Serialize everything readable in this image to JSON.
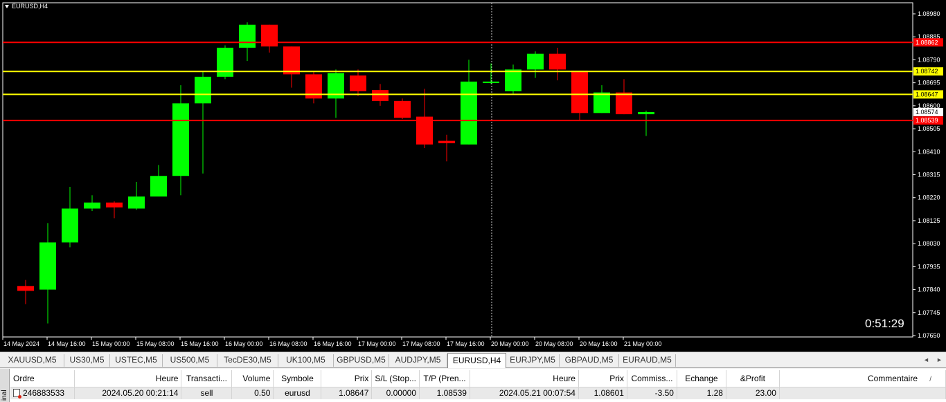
{
  "chart": {
    "symbol_label": "EURUSD,H4",
    "countdown": "0:51:29",
    "colors": {
      "background": "#000000",
      "bull": "#00ff00",
      "bear": "#ff0000",
      "axis_text": "#ffffff",
      "line_red": "#ff0000",
      "line_yellow": "#ffff00"
    },
    "price_axis": {
      "ticks": [
        "1.08980",
        "1.08885",
        "1.08790",
        "1.08695",
        "1.08600",
        "1.08505",
        "1.08410",
        "1.08315",
        "1.08220",
        "1.08125",
        "1.08030",
        "1.07935",
        "1.07840",
        "1.07745",
        "1.07650"
      ]
    },
    "time_axis": {
      "labels": [
        "14 May 2024",
        "14 May 16:00",
        "15 May 00:00",
        "15 May 08:00",
        "15 May 16:00",
        "16 May 00:00",
        "16 May 08:00",
        "16 May 16:00",
        "17 May 00:00",
        "17 May 08:00",
        "17 May 16:00",
        "20 May 00:00",
        "20 May 08:00",
        "20 May 16:00",
        "21 May 00:00"
      ]
    },
    "price_tags": [
      {
        "price": 1.08862,
        "label": "1.08862",
        "bg": "#ff0000",
        "fg": "#ffffff"
      },
      {
        "price": 1.08742,
        "label": "1.08742",
        "bg": "#ffff00",
        "fg": "#000000"
      },
      {
        "price": 1.08647,
        "label": "1.08647",
        "bg": "#ffff00",
        "fg": "#000000"
      },
      {
        "price": 1.08574,
        "label": "1.08574",
        "bg": "#ffffff",
        "fg": "#000000"
      },
      {
        "price": 1.08539,
        "label": "1.08539",
        "bg": "#ff0000",
        "fg": "#ffffff"
      }
    ],
    "horizontal_lines": [
      {
        "price": 1.08862,
        "color": "#ff0000"
      },
      {
        "price": 1.08742,
        "color": "#ffff00"
      },
      {
        "price": 1.08647,
        "color": "#ffff00"
      },
      {
        "price": 1.08539,
        "color": "#ff0000"
      }
    ]
  },
  "chart_data": {
    "type": "candlestick",
    "symbol": "EURUSD",
    "timeframe": "H4",
    "ylim": [
      1.0765,
      1.0898
    ],
    "candles": [
      {
        "o": 1.07855,
        "h": 1.0788,
        "l": 1.0778,
        "c": 1.07835
      },
      {
        "o": 1.0784,
        "h": 1.08115,
        "l": 1.077,
        "c": 1.08035
      },
      {
        "o": 1.08035,
        "h": 1.08265,
        "l": 1.08015,
        "c": 1.08175
      },
      {
        "o": 1.08175,
        "h": 1.0823,
        "l": 1.08165,
        "c": 1.082
      },
      {
        "o": 1.082,
        "h": 1.08205,
        "l": 1.08135,
        "c": 1.0818
      },
      {
        "o": 1.08175,
        "h": 1.08285,
        "l": 1.0817,
        "c": 1.08225
      },
      {
        "o": 1.08225,
        "h": 1.08355,
        "l": 1.08225,
        "c": 1.0831
      },
      {
        "o": 1.0831,
        "h": 1.08685,
        "l": 1.0823,
        "c": 1.0861
      },
      {
        "o": 1.0861,
        "h": 1.0874,
        "l": 1.0832,
        "c": 1.0872
      },
      {
        "o": 1.0872,
        "h": 1.0885,
        "l": 1.0871,
        "c": 1.0884
      },
      {
        "o": 1.0884,
        "h": 1.08945,
        "l": 1.08785,
        "c": 1.08935
      },
      {
        "o": 1.08935,
        "h": 1.08935,
        "l": 1.0882,
        "c": 1.08845
      },
      {
        "o": 1.08845,
        "h": 1.08845,
        "l": 1.08675,
        "c": 1.0873
      },
      {
        "o": 1.0873,
        "h": 1.0874,
        "l": 1.0861,
        "c": 1.0863
      },
      {
        "o": 1.0863,
        "h": 1.0875,
        "l": 1.0855,
        "c": 1.08735
      },
      {
        "o": 1.08725,
        "h": 1.0875,
        "l": 1.0864,
        "c": 1.0866
      },
      {
        "o": 1.08665,
        "h": 1.0869,
        "l": 1.086,
        "c": 1.0862
      },
      {
        "o": 1.0862,
        "h": 1.0863,
        "l": 1.08545,
        "c": 1.0855
      },
      {
        "o": 1.08555,
        "h": 1.0867,
        "l": 1.08425,
        "c": 1.0844
      },
      {
        "o": 1.08455,
        "h": 1.0848,
        "l": 1.0837,
        "c": 1.08445
      },
      {
        "o": 1.0844,
        "h": 1.0879,
        "l": 1.0844,
        "c": 1.087
      },
      {
        "o": 1.087,
        "h": 1.08775,
        "l": 1.0869,
        "c": 1.087
      },
      {
        "o": 1.0866,
        "h": 1.0877,
        "l": 1.0865,
        "c": 1.0875
      },
      {
        "o": 1.0875,
        "h": 1.08825,
        "l": 1.08715,
        "c": 1.08815
      },
      {
        "o": 1.08815,
        "h": 1.0884,
        "l": 1.08705,
        "c": 1.0875
      },
      {
        "o": 1.08745,
        "h": 1.08745,
        "l": 1.0854,
        "c": 1.0857
      },
      {
        "o": 1.0857,
        "h": 1.08685,
        "l": 1.0857,
        "c": 1.08655
      },
      {
        "o": 1.08655,
        "h": 1.0871,
        "l": 1.08565,
        "c": 1.08565
      },
      {
        "o": 1.08565,
        "h": 1.0858,
        "l": 1.08475,
        "c": 1.08574
      }
    ]
  },
  "tabs": {
    "items": [
      {
        "label": "XAUUSD,M5",
        "active": false
      },
      {
        "label": "US30,M5",
        "active": false
      },
      {
        "label": "USTEC,M5",
        "active": false
      },
      {
        "label": "US500,M5",
        "active": false
      },
      {
        "label": "TecDE30,M5",
        "active": false
      },
      {
        "label": "UK100,M5",
        "active": false
      },
      {
        "label": "GBPUSD,M5",
        "active": false
      },
      {
        "label": "AUDJPY,M5",
        "active": false
      },
      {
        "label": "EURUSD,H4",
        "active": true
      },
      {
        "label": "EURJPY,M5",
        "active": false
      },
      {
        "label": "GBPAUD,M5",
        "active": false
      },
      {
        "label": "EURAUD,M5",
        "active": false
      }
    ],
    "scroll_left": "◄",
    "scroll_right": "►"
  },
  "terminal": {
    "side_label": "inal",
    "columns": [
      "Ordre",
      "Heure",
      "Transacti...",
      "Volume",
      "Symbole",
      "Prix",
      "S/L (Stop...",
      "T/P (Pren...",
      "Heure",
      "Prix",
      "Commiss...",
      "Echange",
      "&Profit",
      "Commentaire"
    ],
    "rows": [
      [
        "246883533",
        "2024.05.20 00:21:14",
        "sell",
        "0.50",
        "eurusd",
        "1.08647",
        "0.00000",
        "1.08539",
        "2024.05.21 00:07:54",
        "1.08601",
        "-3.50",
        "1.28",
        "23.00",
        ""
      ]
    ],
    "sort_indicator": "/"
  }
}
